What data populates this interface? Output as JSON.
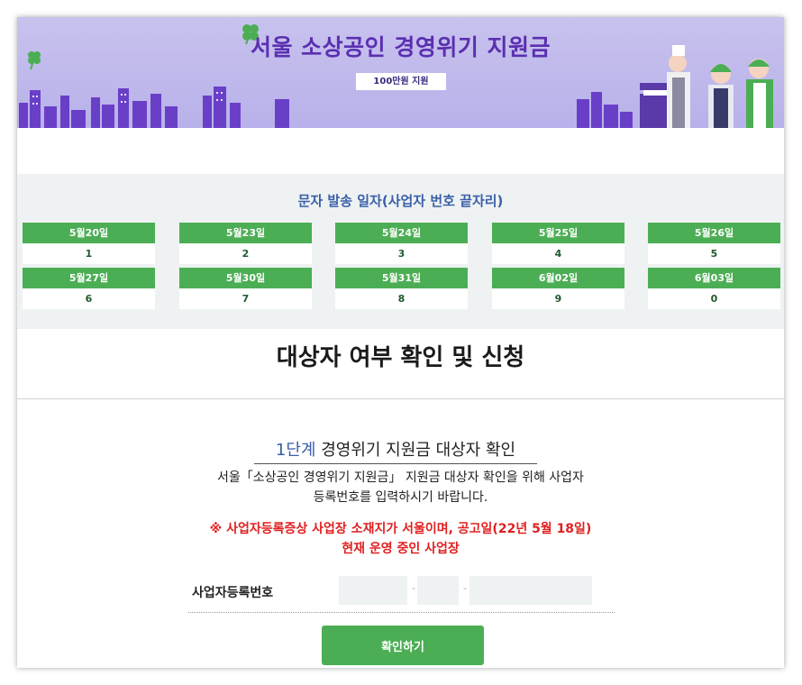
{
  "banner": {
    "title": "서울 소상공인 경영위기 지원금",
    "badge": "100만원 지원"
  },
  "schedule": {
    "title": "문자 발송 일자(사업자 번호 끝자리)",
    "days": [
      {
        "date": "5월20일",
        "digit": "1"
      },
      {
        "date": "5월23일",
        "digit": "2"
      },
      {
        "date": "5월24일",
        "digit": "3"
      },
      {
        "date": "5월25일",
        "digit": "4"
      },
      {
        "date": "5월26일",
        "digit": "5"
      },
      {
        "date": "5월27일",
        "digit": "6"
      },
      {
        "date": "5월30일",
        "digit": "7"
      },
      {
        "date": "5월31일",
        "digit": "8"
      },
      {
        "date": "6월02일",
        "digit": "9"
      },
      {
        "date": "6월03일",
        "digit": "0"
      }
    ]
  },
  "section": {
    "heading": "대상자 여부 확인 및 신청"
  },
  "step": {
    "number": "1단계",
    "title": "경영위기 지원금 대상자 확인",
    "desc_line1": "서울「소상공인 경영위기 지원금」 지원금 대상자 확인을 위해 사업자",
    "desc_line2": "등록번호를 입력하시기 바랍니다.",
    "notice_line1": "※ 사업자등록증상 사업장 소재지가 서울이며, 공고일(22년 5월 18일)",
    "notice_line2": "현재 운영 중인 사업장"
  },
  "form": {
    "label": "사업자등록번호",
    "part1": "",
    "part2": "",
    "part3": "",
    "separator": "-",
    "confirm_label": "확인하기"
  },
  "colors": {
    "accent_green": "#4cae54",
    "banner_purple": "#b8b1ea",
    "title_purple": "#5a2fb0",
    "notice_red": "#e02020",
    "link_blue": "#3a5fa8"
  }
}
